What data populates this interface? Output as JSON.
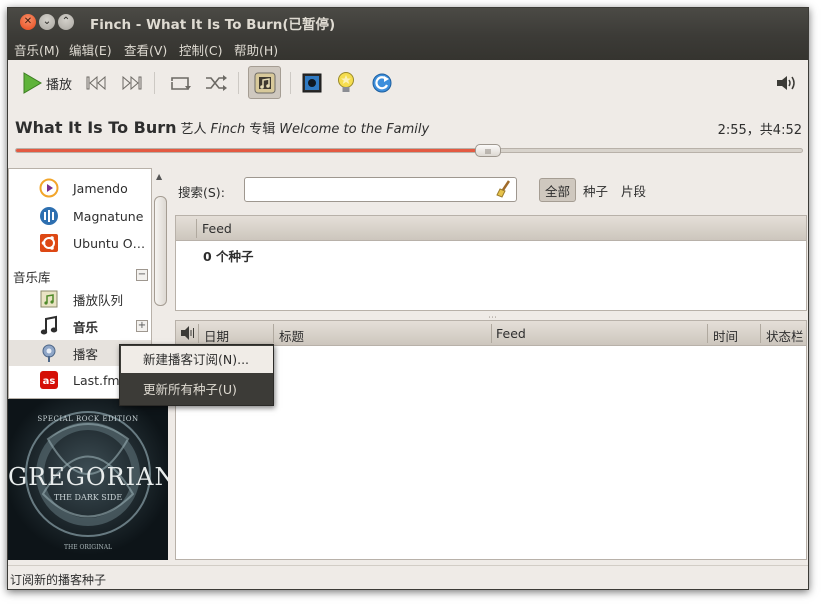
{
  "window": {
    "title": "Finch - What It Is To Burn(已暂停)"
  },
  "menubar": {
    "items": [
      "音乐(M)",
      "编辑(E)",
      "查看(V)",
      "控制(C)",
      "帮助(H)"
    ]
  },
  "toolbar": {
    "play_label": "播放"
  },
  "now_playing": {
    "song": "What It Is To Burn",
    "artist_prefix": "艺人",
    "artist": "Finch",
    "album_prefix": "专辑",
    "album": "Welcome to the Family",
    "time": "2:55，共4:52",
    "progress_fraction": 0.6
  },
  "sidebar": {
    "stores": [
      {
        "label": "Jamendo",
        "icon": "jamendo-icon"
      },
      {
        "label": "Magnatune",
        "icon": "magnatune-icon"
      },
      {
        "label": "Ubuntu O…",
        "icon": "ubuntu-one-icon"
      }
    ],
    "library_header": "音乐库",
    "library": [
      {
        "label": "播放队列",
        "icon": "play-queue-icon"
      },
      {
        "label": "音乐",
        "icon": "music-note-icon"
      },
      {
        "label": "播客",
        "icon": "podcast-icon"
      },
      {
        "label": "Last.fm",
        "icon": "lastfm-icon"
      }
    ]
  },
  "album_art": {
    "edition": "SPECIAL ROCK EDITION",
    "band": "GREGORIAN",
    "subtitle": "THE DARK SIDE",
    "footer": "THE ORIGINAL"
  },
  "search": {
    "label": "搜索(S):",
    "value": "",
    "filters": [
      "全部",
      "种子",
      "片段"
    ]
  },
  "feeds": {
    "header": "Feed",
    "summary": "0 个种子"
  },
  "episodes": {
    "columns": [
      "日期",
      "标题",
      "Feed",
      "时间",
      "状态栏"
    ]
  },
  "context_menu": {
    "items": [
      "新建播客订阅(N)...",
      "更新所有种子(U)"
    ]
  },
  "status": {
    "text": "订阅新的播客种子"
  },
  "colors": {
    "titlebar": "#3c3b37",
    "accent_seek": "#e35a42",
    "window_bg": "#efebe7"
  }
}
